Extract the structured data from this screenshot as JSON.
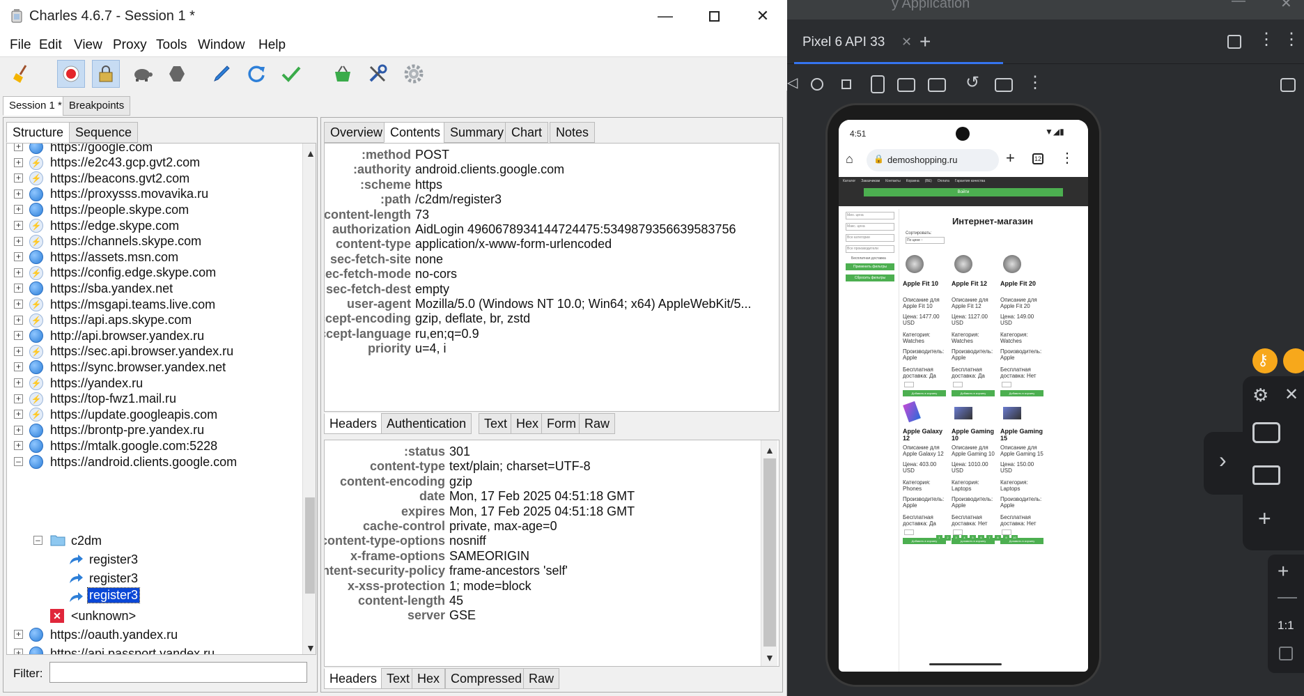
{
  "charles": {
    "title": "Charles 4.6.7 - Session 1 *",
    "menu": [
      "File",
      "Edit",
      "View",
      "Proxy",
      "Tools",
      "Window",
      "Help"
    ],
    "session_tabs": [
      "Session 1 *",
      "Breakpoints"
    ],
    "left_tabs": [
      "Structure",
      "Sequence"
    ],
    "tree": [
      {
        "label": "https://google.com",
        "icon": "globe-icon",
        "expanded": false
      },
      {
        "label": "https://e2c43.gcp.gvt2.com",
        "icon": "bolt-icon",
        "expanded": false
      },
      {
        "label": "https://beacons.gvt2.com",
        "icon": "bolt-icon",
        "expanded": false
      },
      {
        "label": "https://proxysss.movavika.ru",
        "icon": "globe-icon",
        "expanded": false
      },
      {
        "label": "https://people.skype.com",
        "icon": "globe-icon",
        "expanded": false
      },
      {
        "label": "https://edge.skype.com",
        "icon": "bolt-icon",
        "expanded": false
      },
      {
        "label": "https://channels.skype.com",
        "icon": "bolt-icon",
        "expanded": false
      },
      {
        "label": "https://assets.msn.com",
        "icon": "globe-icon",
        "expanded": false
      },
      {
        "label": "https://config.edge.skype.com",
        "icon": "bolt-icon",
        "expanded": false
      },
      {
        "label": "https://sba.yandex.net",
        "icon": "globe-icon",
        "expanded": false
      },
      {
        "label": "https://msgapi.teams.live.com",
        "icon": "bolt-icon",
        "expanded": false
      },
      {
        "label": "https://api.aps.skype.com",
        "icon": "bolt-icon",
        "expanded": false
      },
      {
        "label": "http://api.browser.yandex.ru",
        "icon": "globe-icon",
        "expanded": false
      },
      {
        "label": "https://sec.api.browser.yandex.ru",
        "icon": "bolt-icon",
        "expanded": false
      },
      {
        "label": "https://sync.browser.yandex.net",
        "icon": "globe-icon",
        "expanded": false
      },
      {
        "label": "https://yandex.ru",
        "icon": "bolt-icon",
        "expanded": false
      },
      {
        "label": "https://top-fwz1.mail.ru",
        "icon": "bolt-icon",
        "expanded": false
      },
      {
        "label": "https://update.googleapis.com",
        "icon": "bolt-icon",
        "expanded": false
      },
      {
        "label": "https://brontp-pre.yandex.ru",
        "icon": "globe-icon",
        "expanded": false
      },
      {
        "label": "https://mtalk.google.com:5228",
        "icon": "globe-icon",
        "expanded": false
      },
      {
        "label": "https://android.clients.google.com",
        "icon": "globe-icon",
        "expanded": true
      }
    ],
    "tree_folder": "c2dm",
    "tree_requests": [
      "register3",
      "register3",
      "register3"
    ],
    "tree_unknown": "<unknown>",
    "tree_after": [
      {
        "label": "https://oauth.yandex.ru",
        "icon": "globe-icon"
      },
      {
        "label": "https://api.passport.yandex.ru",
        "icon": "globe-icon"
      }
    ],
    "filter_label": "Filter:",
    "filter_value": "",
    "right_tabs": [
      "Overview",
      "Contents",
      "Summary",
      "Chart",
      "Notes"
    ],
    "request_headers": [
      {
        "k": ":method",
        "v": "POST"
      },
      {
        "k": ":authority",
        "v": "android.clients.google.com"
      },
      {
        "k": ":scheme",
        "v": "https"
      },
      {
        "k": ":path",
        "v": "/c2dm/register3"
      },
      {
        "k": "content-length",
        "v": "73"
      },
      {
        "k": "authorization",
        "v": "AidLogin 4960678934144724475:5349879356639583756"
      },
      {
        "k": "content-type",
        "v": "application/x-www-form-urlencoded"
      },
      {
        "k": "sec-fetch-site",
        "v": "none"
      },
      {
        "k": "sec-fetch-mode",
        "v": "no-cors"
      },
      {
        "k": "sec-fetch-dest",
        "v": "empty"
      },
      {
        "k": "user-agent",
        "v": "Mozilla/5.0 (Windows NT 10.0; Win64; x64) AppleWebKit/5..."
      },
      {
        "k": "accept-encoding",
        "v": "gzip, deflate, br, zstd"
      },
      {
        "k": "accept-language",
        "v": "ru,en;q=0.9"
      },
      {
        "k": "priority",
        "v": "u=4, i"
      }
    ],
    "request_subtabs": [
      "Headers",
      "Authentication",
      "Text",
      "Hex",
      "Form",
      "Raw"
    ],
    "response_headers": [
      {
        "k": ":status",
        "v": "301"
      },
      {
        "k": "content-type",
        "v": "text/plain; charset=UTF-8"
      },
      {
        "k": "content-encoding",
        "v": "gzip"
      },
      {
        "k": "date",
        "v": "Mon, 17 Feb 2025 04:51:18 GMT"
      },
      {
        "k": "expires",
        "v": "Mon, 17 Feb 2025 04:51:18 GMT"
      },
      {
        "k": "cache-control",
        "v": "private, max-age=0"
      },
      {
        "k": "x-content-type-options",
        "v": "nosniff"
      },
      {
        "k": "x-frame-options",
        "v": "SAMEORIGIN"
      },
      {
        "k": "content-security-policy",
        "v": "frame-ancestors 'self'"
      },
      {
        "k": "x-xss-protection",
        "v": "1; mode=block"
      },
      {
        "k": "content-length",
        "v": "45"
      },
      {
        "k": "server",
        "v": "GSE"
      }
    ],
    "response_subtabs": [
      "Headers",
      "Text",
      "Hex",
      "Compressed",
      "Raw"
    ]
  },
  "emulator": {
    "title_fragment": "y Application",
    "device_tab": "Pixel 6 API 33",
    "zoom_label": "1:1",
    "phone": {
      "time": "4:51",
      "url": "demoshopping.ru",
      "tab_count": "12",
      "nav": [
        "Каталог",
        "Заказчикам",
        "Контакты",
        "Корзина",
        "(ВЕ)",
        "Оплата",
        "Гарантия качества"
      ],
      "login_button": "Войти",
      "page_title": "Интернет-магазин",
      "sort_label": "Сортировать:",
      "sort_value": "По цене ↑",
      "filters": [
        "Мин. цена",
        "Макс. цена",
        "Все категории",
        "Все производители"
      ],
      "free_delivery_filter": "Бесплатная доставка",
      "apply_button": "Применить фильтры",
      "reset_button": "Сбросить фильтры",
      "products": [
        {
          "name": "Apple Fit 10",
          "desc": "Описание для Apple Fit 10",
          "price": "Цена: 1477.00 USD",
          "cat": "Категория: Watches",
          "maker": "Производитель: Apple",
          "delivery": "Бесплатная доставка: Да",
          "kind": "watch"
        },
        {
          "name": "Apple Fit 12",
          "desc": "Описание для Apple Fit 12",
          "price": "Цена: 1127.00 USD",
          "cat": "Категория: Watches",
          "maker": "Производитель: Apple",
          "delivery": "Бесплатная доставка: Да",
          "kind": "watch"
        },
        {
          "name": "Apple Fit 20",
          "desc": "Описание для Apple Fit 20",
          "price": "Цена: 149.00 USD",
          "cat": "Категория: Watches",
          "maker": "Производитель: Apple",
          "delivery": "Бесплатная доставка: Нет",
          "kind": "watch"
        },
        {
          "name": "Apple Galaxy 12",
          "desc": "Описание для Apple Galaxy 12",
          "price": "Цена: 403.00 USD",
          "cat": "Категория: Phones",
          "maker": "Производитель: Apple",
          "delivery": "Бесплатная доставка: Да",
          "kind": "phone"
        },
        {
          "name": "Apple Gaming 10",
          "desc": "Описание для Apple Gaming 10",
          "price": "Цена: 1010.00 USD",
          "cat": "Категория: Laptops",
          "maker": "Производитель: Apple",
          "delivery": "Бесплатная доставка: Нет",
          "kind": "laptop"
        },
        {
          "name": "Apple Gaming 15",
          "desc": "Описание для Apple Gaming 15",
          "price": "Цена: 150.00 USD",
          "cat": "Категория: Laptops",
          "maker": "Производитель: Apple",
          "delivery": "Бесплатная доставка: Нет",
          "kind": "laptop"
        }
      ],
      "add_to_cart": "Добавить в корзину",
      "pages": [
        "1",
        "2",
        "3",
        "4",
        "5",
        "6",
        "7",
        "8",
        "9",
        "10"
      ]
    }
  },
  "colors": {
    "record": "#e4262b",
    "green": "#4caf50",
    "selection_border": "#1a4ed8",
    "accent_blue": "#2d7fd8"
  }
}
